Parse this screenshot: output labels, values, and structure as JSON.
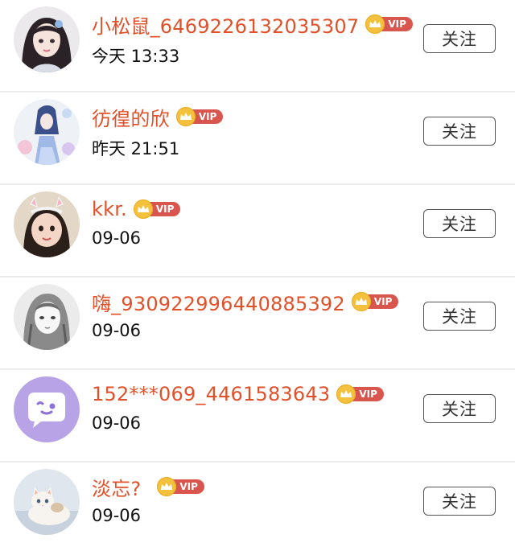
{
  "follow_label": "关注",
  "vip_label": "VIP",
  "colors": {
    "username": "#e0512a",
    "vip_tag": "#d9564e",
    "crown": "#f3c13c"
  },
  "users": [
    {
      "name": "小松鼠_6469226132035307",
      "time": "今天 13:33",
      "avatar_icon": "anime-girl-avatar"
    },
    {
      "name": "彷徨的欣",
      "time": "昨天 21:51",
      "avatar_icon": "blue-dress-girl-avatar"
    },
    {
      "name": "kkr.",
      "time": "09-06",
      "avatar_icon": "child-with-headband-avatar"
    },
    {
      "name": "嗨_930922996440885392",
      "time": "09-06",
      "avatar_icon": "sketch-girl-avatar"
    },
    {
      "name": "152***069_4461583643",
      "time": "09-06",
      "avatar_icon": "chat-bubble-avatar"
    },
    {
      "name": "淡忘?",
      "time": "09-06",
      "avatar_icon": "kitten-avatar"
    }
  ]
}
